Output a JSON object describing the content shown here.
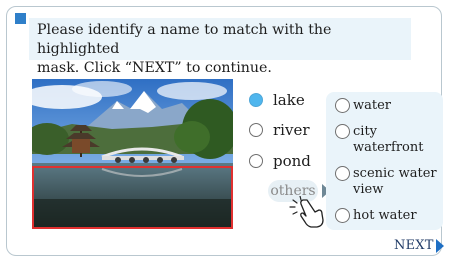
{
  "instructions": {
    "icon": "blue-square-marker",
    "line1": "Please identify a name to match with the highlighted",
    "line2": "mask. Click “NEXT” to continue."
  },
  "image": {
    "description": "landscape-with-pagoda-bridge-mountains",
    "mask_color": "#e03030"
  },
  "options": [
    {
      "label": "lake",
      "selected": true
    },
    {
      "label": "river",
      "selected": false
    },
    {
      "label": "pond",
      "selected": false
    }
  ],
  "others_button": {
    "label": "others"
  },
  "more_options": [
    {
      "lines": [
        "water"
      ],
      "selected": false
    },
    {
      "lines": [
        "city",
        "waterfront"
      ],
      "selected": false
    },
    {
      "lines": [
        "scenic water",
        "view"
      ],
      "selected": false
    },
    {
      "lines": [
        "hot water"
      ],
      "selected": false
    }
  ],
  "next_button": {
    "label": "NEXT"
  },
  "colors": {
    "accent": "#2f7fc9",
    "selected_radio": "#4fb6ee",
    "panel_bg": "#eaf4fa",
    "next_text": "#1f3a66"
  }
}
